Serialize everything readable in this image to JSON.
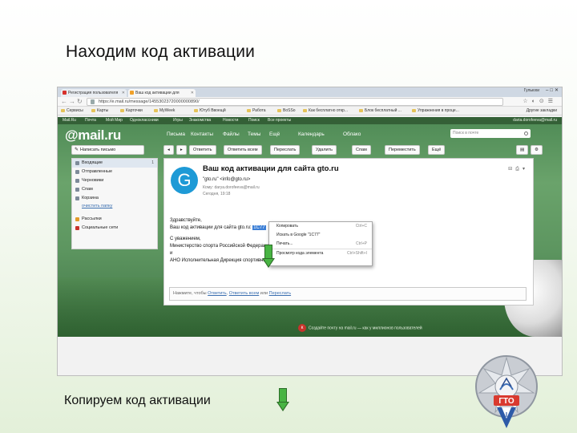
{
  "slide": {
    "title": "Находим код активации",
    "caption": "Копируем код активации"
  },
  "browser": {
    "tabs": [
      {
        "label": "Регистрация пользователя",
        "favicon_color": "#d7312c"
      },
      {
        "label": "Ваш код активации для",
        "favicon_color": "#f0a12a"
      }
    ],
    "user_chip": "Гульюхи",
    "url": "https://e.mail.ru/message/14553023720000000890/",
    "bookmarks": [
      "Сервисы",
      "Карты",
      "Карточки",
      "MyWeek",
      "Ютуб Ввоещй",
      "Работа",
      "BoSSo",
      "Как бесплатно откр...",
      "Блок бесплатный ...",
      "Упражнения в проце..."
    ],
    "other_bookmarks": "Другие закладки"
  },
  "mail": {
    "portal": [
      "Mail.Ru",
      "Почта",
      "Мой Мир",
      "Одноклассники",
      "Игры",
      "Знакомства",
      "Новости",
      "Поиск",
      "Все проекты"
    ],
    "account": "daria.dorofeeva@mail.ru",
    "logo_at": "@",
    "logo_text": "mail.ru",
    "nav": [
      "Письма",
      "Контакты",
      "Файлы",
      "Темы",
      "Ещё",
      "Календарь",
      "Облако"
    ],
    "search_placeholder": "Поиск в почте",
    "compose": "Написать письмо",
    "toolbar": [
      "Ответить",
      "Ответить всем",
      "Переслать",
      "Удалить",
      "Спам",
      "Переместить",
      "Ещё"
    ],
    "folders": [
      {
        "label": "Входящие",
        "count": "1",
        "active": true
      },
      {
        "label": "Отправленные"
      },
      {
        "label": "Черновики"
      },
      {
        "label": "Спам"
      },
      {
        "label": "Корзина"
      }
    ],
    "clean_link": "очистить папку",
    "folders2": [
      {
        "label": "Рассылки"
      },
      {
        "label": "Социальные сети"
      }
    ],
    "letter": {
      "avatar": "G",
      "subject": "Ваш код активации для сайта gto.ru",
      "sender": "\"gto.ru\" <info@gto.ru>",
      "to": "Кому: darya.dorofeeva@mail.ru",
      "date": "Сегодня, 19:18",
      "greeting": "Здравствуйте,",
      "code_line_prefix": "Ваш код активации для сайта gto.ru:",
      "code": "1С77",
      "respect": "С уважением,",
      "org1": "Министерство спорта Российской Федерации",
      "org2": "и",
      "org3": "АНО Исполнительная Дирекция спортивных",
      "reply_prompt": "Нажмите, чтобы",
      "reply_link1": "Ответить",
      "reply_middle": ",",
      "reply_link2": "Ответить всем",
      "reply_tail": "или",
      "reply_link3": "Переслать"
    },
    "context_menu": [
      {
        "label": "Копировать",
        "shortcut": "Ctrl+C"
      },
      {
        "label": "Искать в Google \"1С77\"",
        "shortcut": ""
      },
      {
        "label": "Печать...",
        "shortcut": "Ctrl+P"
      },
      {
        "label": "Просмотр кода элемента",
        "shortcut": "Ctrl+Shift+I"
      }
    ],
    "footer": "Создайте почту на mail.ru — как у миллионов пользователей"
  },
  "emblem": {
    "label": "ГТО"
  },
  "colors": {
    "accent_arrow": "#48b443",
    "highlight": "#3c7fd6",
    "avatar": "#1e9ad6"
  }
}
